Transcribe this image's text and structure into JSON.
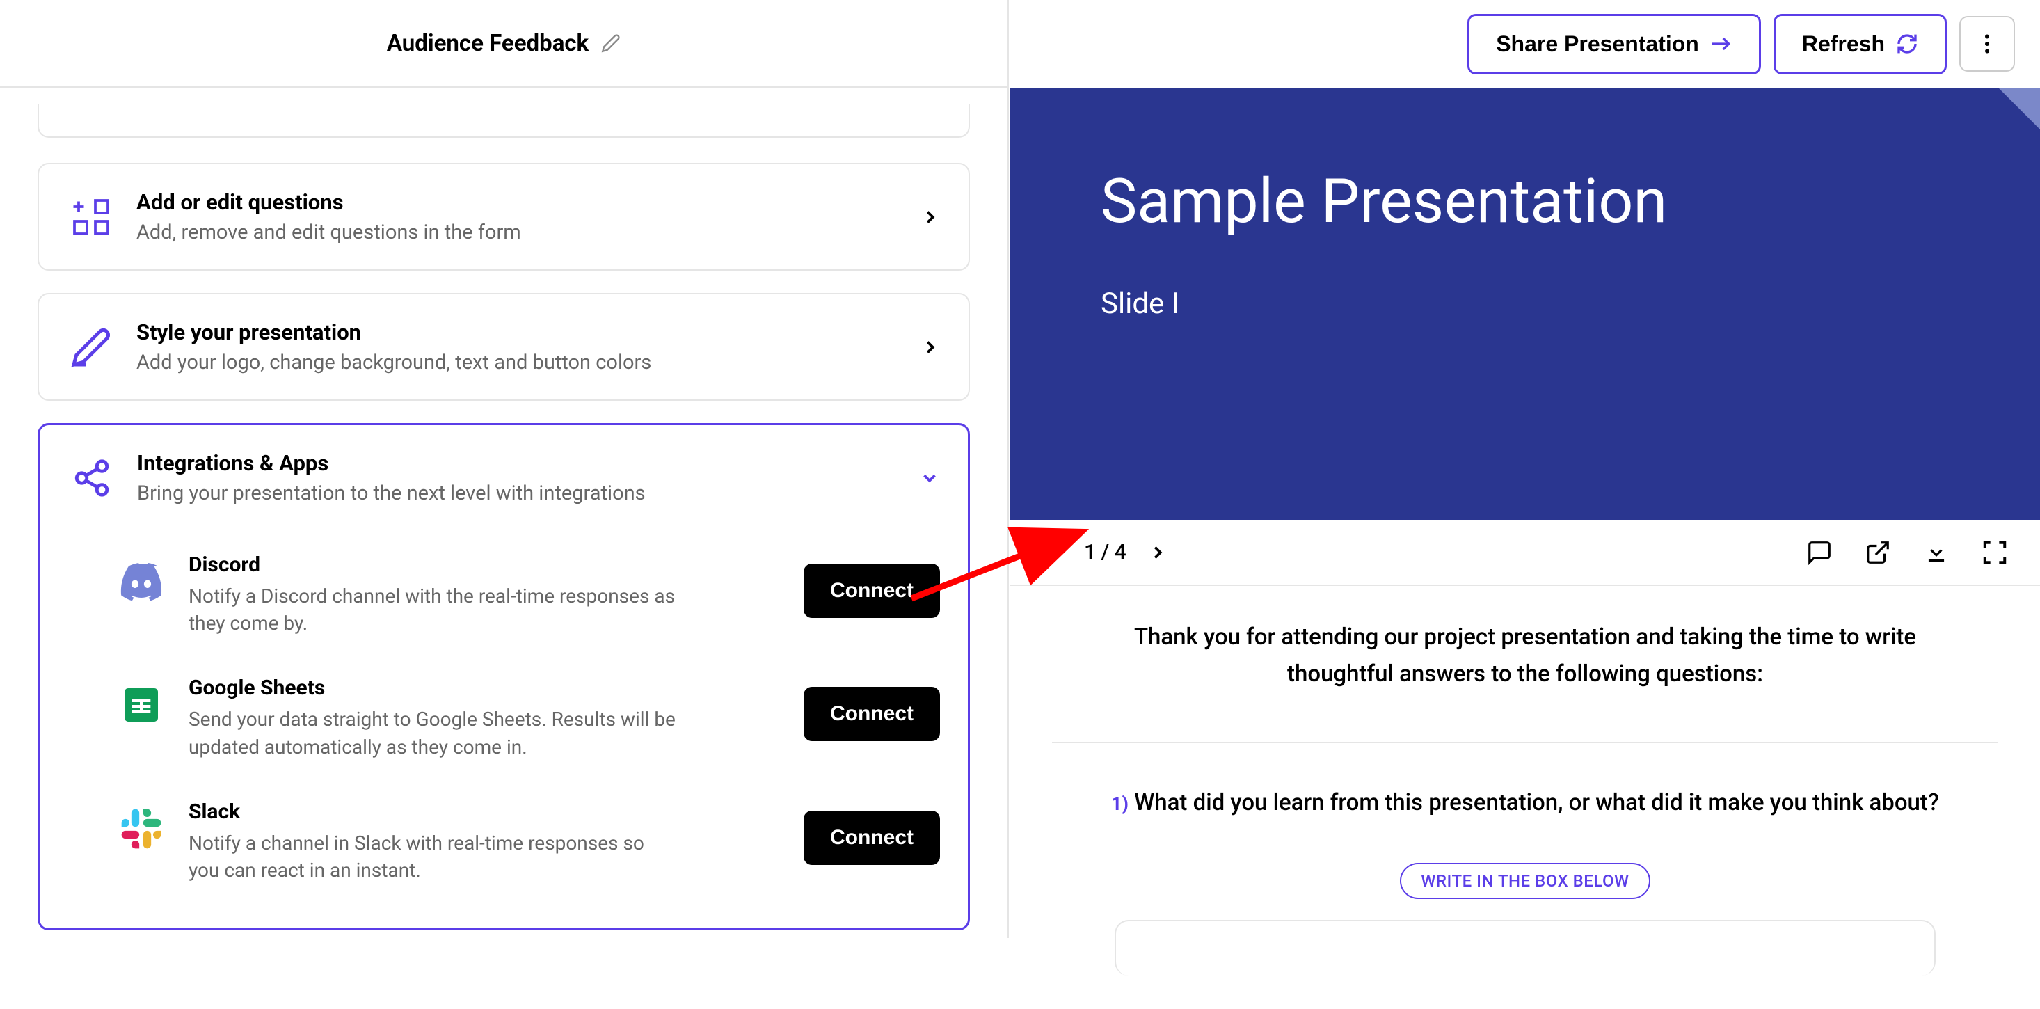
{
  "header": {
    "title": "Audience Feedback"
  },
  "cards": {
    "questions": {
      "title": "Add or edit questions",
      "subtitle": "Add, remove and edit questions in the form"
    },
    "style": {
      "title": "Style your presentation",
      "subtitle": "Add your logo, change background, text and button colors"
    },
    "integrations": {
      "title": "Integrations & Apps",
      "subtitle": "Bring your presentation to the next level with integrations"
    }
  },
  "integrations": {
    "connect_label": "Connect",
    "items": [
      {
        "name": "Discord",
        "description": "Notify a Discord channel with the real-time responses as they come by."
      },
      {
        "name": "Google Sheets",
        "description": "Send your data straight to Google Sheets. Results will be updated automatically as they come in."
      },
      {
        "name": "Slack",
        "description": "Notify a channel in Slack with real-time responses so you can react in an instant."
      }
    ]
  },
  "actions": {
    "share": "Share Presentation",
    "refresh": "Refresh"
  },
  "slide": {
    "title": "Sample Presentation",
    "subtitle": "Slide I",
    "page": "1 / 4"
  },
  "form": {
    "intro": "Thank you for attending our project presentation and taking the time to write thoughtful answers to the following questions:",
    "question_number": "1)",
    "question_text": "What did you learn from this presentation, or what did it make you think about?",
    "hint": "WRITE IN THE BOX BELOW"
  },
  "colors": {
    "accent": "#5b3ee8",
    "slide_bg": "#2a3690"
  }
}
